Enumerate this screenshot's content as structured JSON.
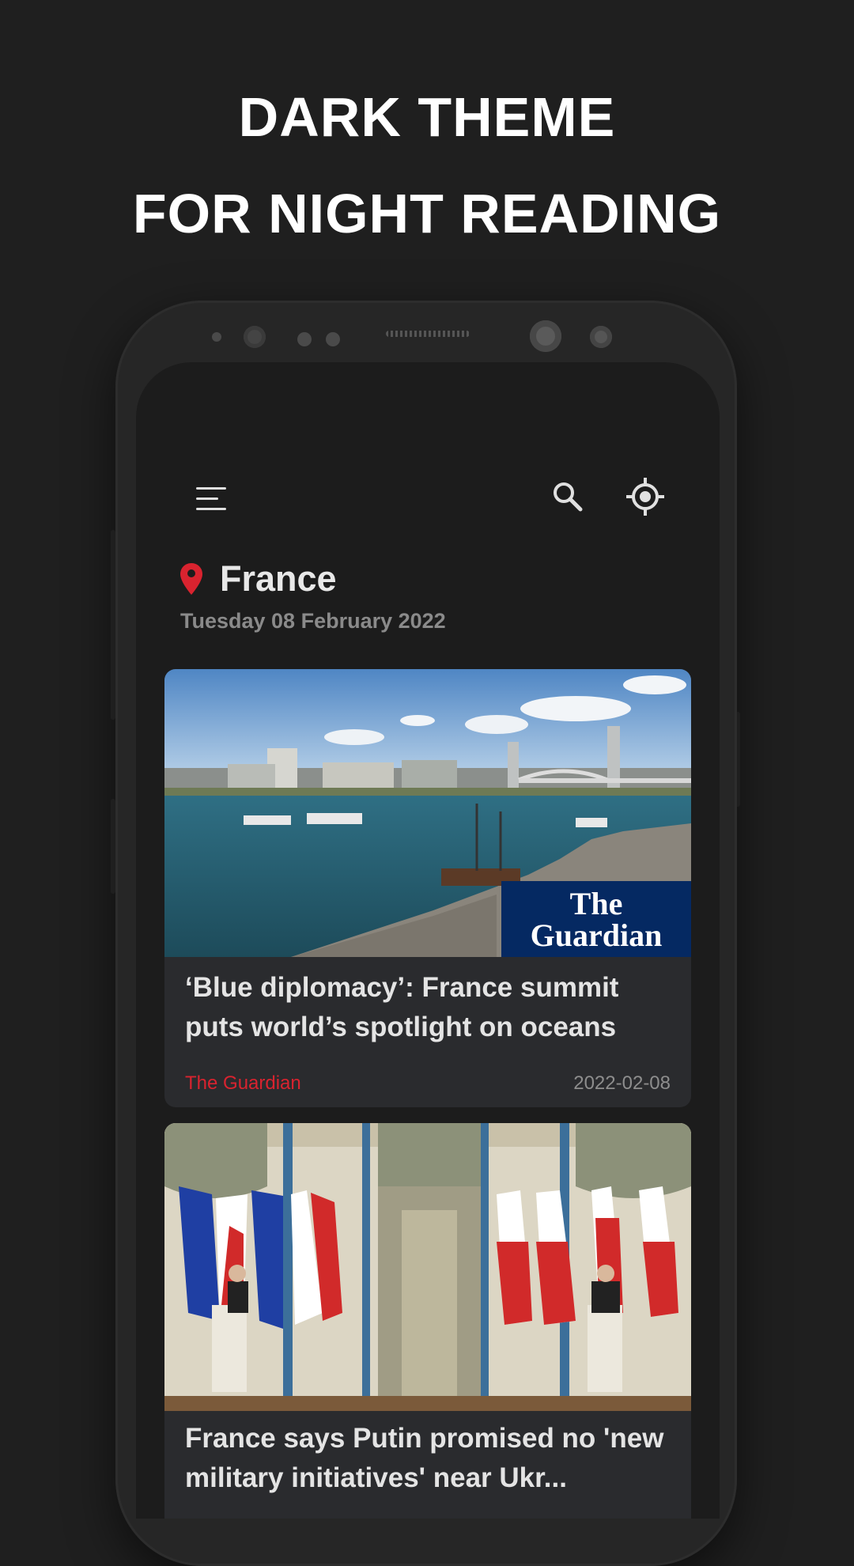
{
  "promo": {
    "line1": "DARK THEME",
    "line2": "FOR NIGHT READING"
  },
  "toolbar": {
    "menu_icon": "hamburger-menu-icon",
    "search_icon": "search-icon",
    "locate_icon": "location-crosshair-icon"
  },
  "location": {
    "pin_icon": "map-pin-icon",
    "name": "France",
    "date": "Tuesday 08 February 2022"
  },
  "articles": [
    {
      "title": "‘Blue diplomacy’: France summit puts world’s spotlight on oceans",
      "source": "The Guardian",
      "date": "2022-02-08",
      "image": "harbor-photo",
      "badge_line1": "The",
      "badge_line2": "Guardian"
    },
    {
      "title": "France says Putin promised no 'new military initiatives' near Ukr...",
      "image": "press-conference-photo"
    }
  ],
  "colors": {
    "accent": "#d9232f",
    "background": "#1f1f1f",
    "card": "#2a2b2e",
    "guardian_badge": "#052962"
  }
}
